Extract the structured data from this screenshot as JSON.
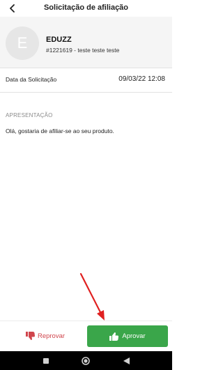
{
  "header": {
    "title": "Solicitação de afiliação",
    "back_icon": "chevron-left-icon"
  },
  "product": {
    "avatar_initial": "E",
    "name": "EDUZZ",
    "code": "#1221619 - teste teste teste"
  },
  "request": {
    "date_label": "Data da Solicitação",
    "date_value": "09/03/22 12:08"
  },
  "presentation": {
    "label": "APRESENTAÇÃO",
    "text": "Olá, gostaria de afiliar-se ao seu produto."
  },
  "actions": {
    "reject_label": "Reprovar",
    "reject_icon": "thumbs-down-icon",
    "approve_label": "Aprovar",
    "approve_icon": "thumbs-up-icon"
  },
  "colors": {
    "approve": "#3aa64a",
    "reject": "#d0454c",
    "annotation": "#e02020"
  },
  "navbar": {
    "icons": [
      "square-icon",
      "circle-icon",
      "triangle-back-icon"
    ]
  }
}
